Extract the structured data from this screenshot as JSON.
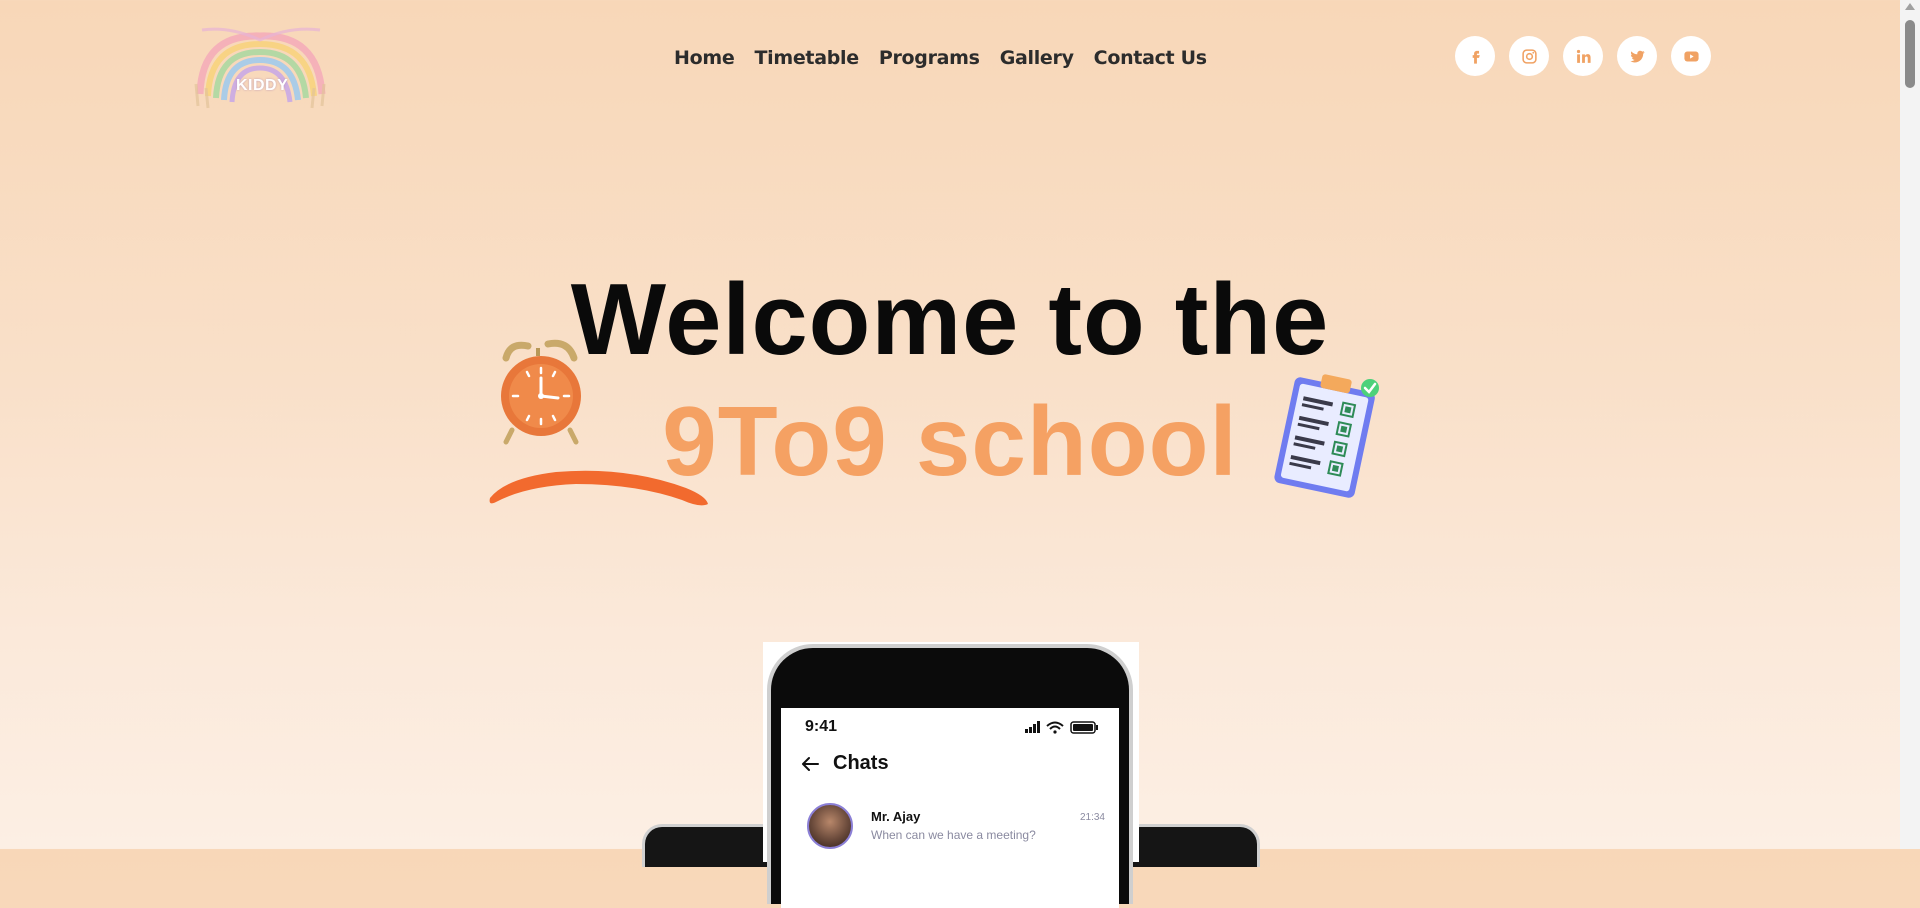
{
  "brand": {
    "logo_text": "KIDDY"
  },
  "nav": {
    "items": [
      "Home",
      "Timetable",
      "Programs",
      "Gallery",
      "Contact Us"
    ]
  },
  "socials": [
    "facebook-icon",
    "instagram-icon",
    "linkedin-icon",
    "twitter-icon",
    "youtube-icon"
  ],
  "hero": {
    "line1": "Welcome to the",
    "line2": "9To9 school"
  },
  "phone": {
    "status_time": "9:41",
    "screen_title": "Chats",
    "chat": {
      "name": "Mr. Ajay",
      "message": "When can we have a meeting?",
      "time": "21:34"
    }
  },
  "colors": {
    "accent": "#f5a163",
    "brush": "#f26a2e",
    "text": "#0a0a0a"
  }
}
